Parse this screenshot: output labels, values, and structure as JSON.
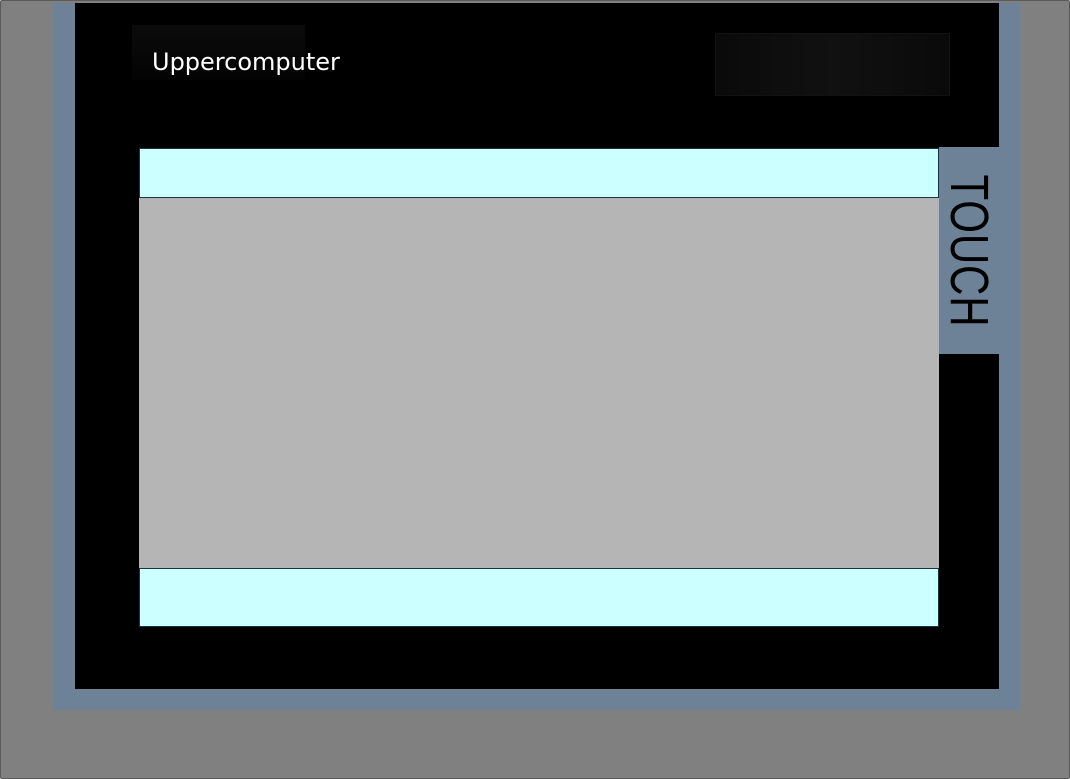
{
  "panel": {
    "brand_label": "Uppercomputer",
    "touch_label": "TOUCH"
  },
  "colors": {
    "window_background": "#808080",
    "frame": "#6d8296",
    "bezel": "#000000",
    "screen_header": "#ccffff",
    "screen_body": "#b5b5b5",
    "screen_footer": "#ccffff"
  }
}
